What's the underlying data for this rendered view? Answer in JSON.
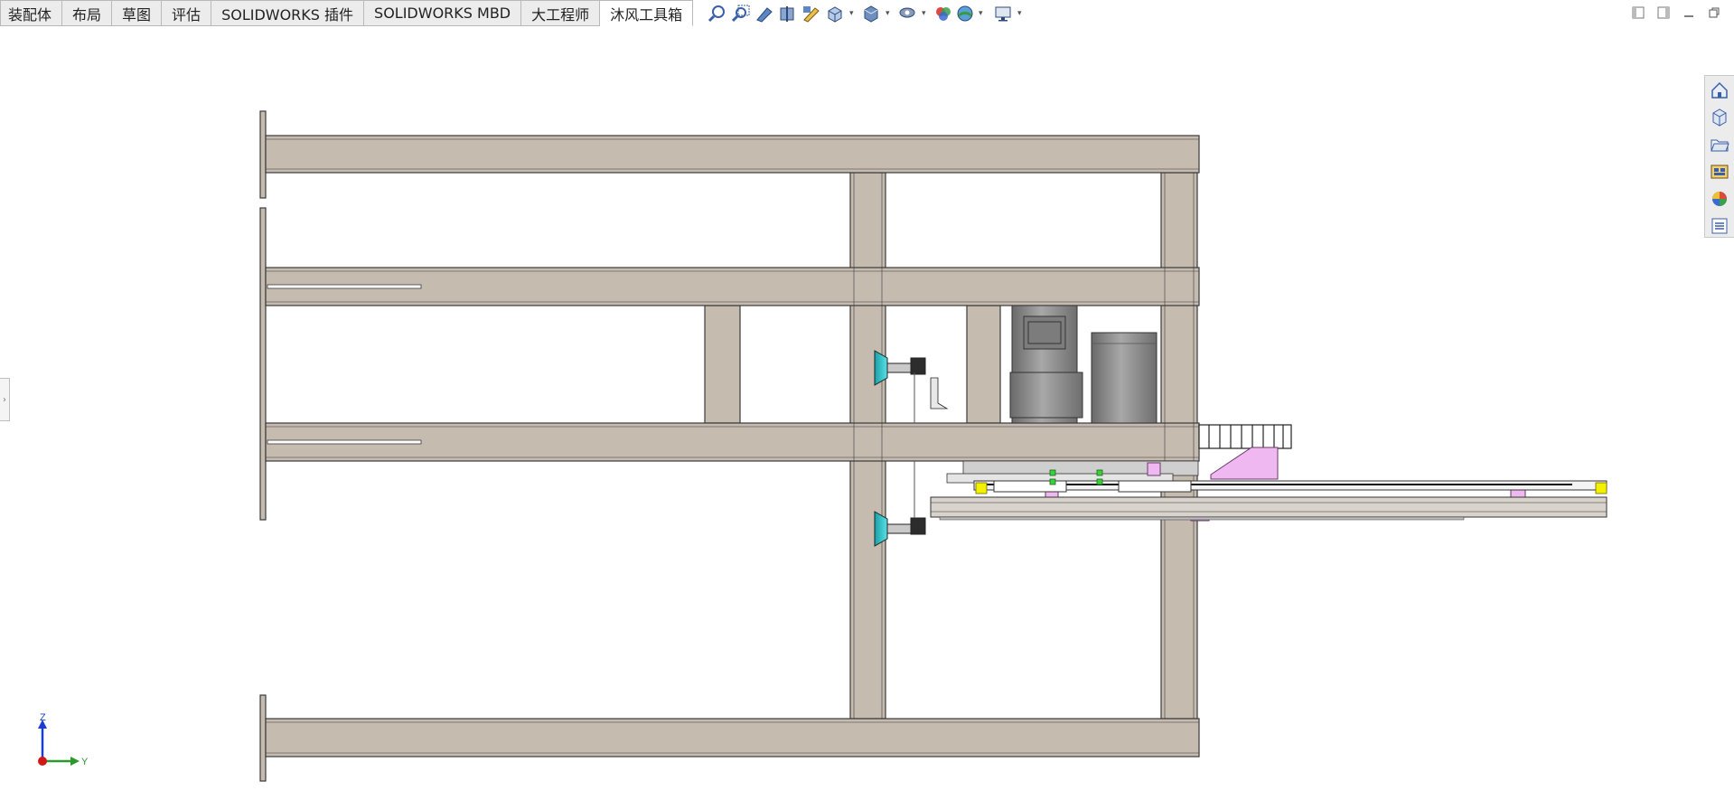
{
  "command_manager": {
    "tabs": [
      {
        "label": "装配体"
      },
      {
        "label": "布局"
      },
      {
        "label": "草图"
      },
      {
        "label": "评估"
      },
      {
        "label": "SOLIDWORKS 插件"
      },
      {
        "label": "SOLIDWORKS MBD"
      },
      {
        "label": "大工程师"
      },
      {
        "label": "沐风工具箱"
      }
    ],
    "active_tab": "沐风工具箱"
  },
  "view_toolbar": {
    "icons": [
      "zoom-to-fit-icon",
      "zoom-to-area-icon",
      "previous-view-icon",
      "section-view-icon",
      "dynamic-annotation-view-icon",
      "view-orientation-icon",
      "display-style-icon",
      "hide-show-items-icon",
      "edit-appearance-icon",
      "apply-scene-icon",
      "view-settings-icon"
    ]
  },
  "window_controls": [
    "tile-left-icon",
    "tile-right-icon",
    "minimize-icon",
    "restore-icon"
  ],
  "task_pane": {
    "icons": [
      "solidworks-resources-icon",
      "design-library-icon",
      "file-explorer-icon",
      "view-palette-icon",
      "appearances-scenes-icon",
      "custom-properties-icon"
    ]
  },
  "triad": {
    "z_label": "Z",
    "y_label": "Y"
  },
  "colors": {
    "frame_fill": "#c5bbaf",
    "frame_edge": "#3a3a3a",
    "motor_gray": "#8e8e8e",
    "vacuum_cup": "#35c8d0",
    "bracket_pink": "#f0b8f0",
    "end_stop_yellow": "#f5f000",
    "triad_z": "#1a3fd0",
    "triad_y": "#2a9a2a",
    "triad_origin": "#d01818"
  }
}
